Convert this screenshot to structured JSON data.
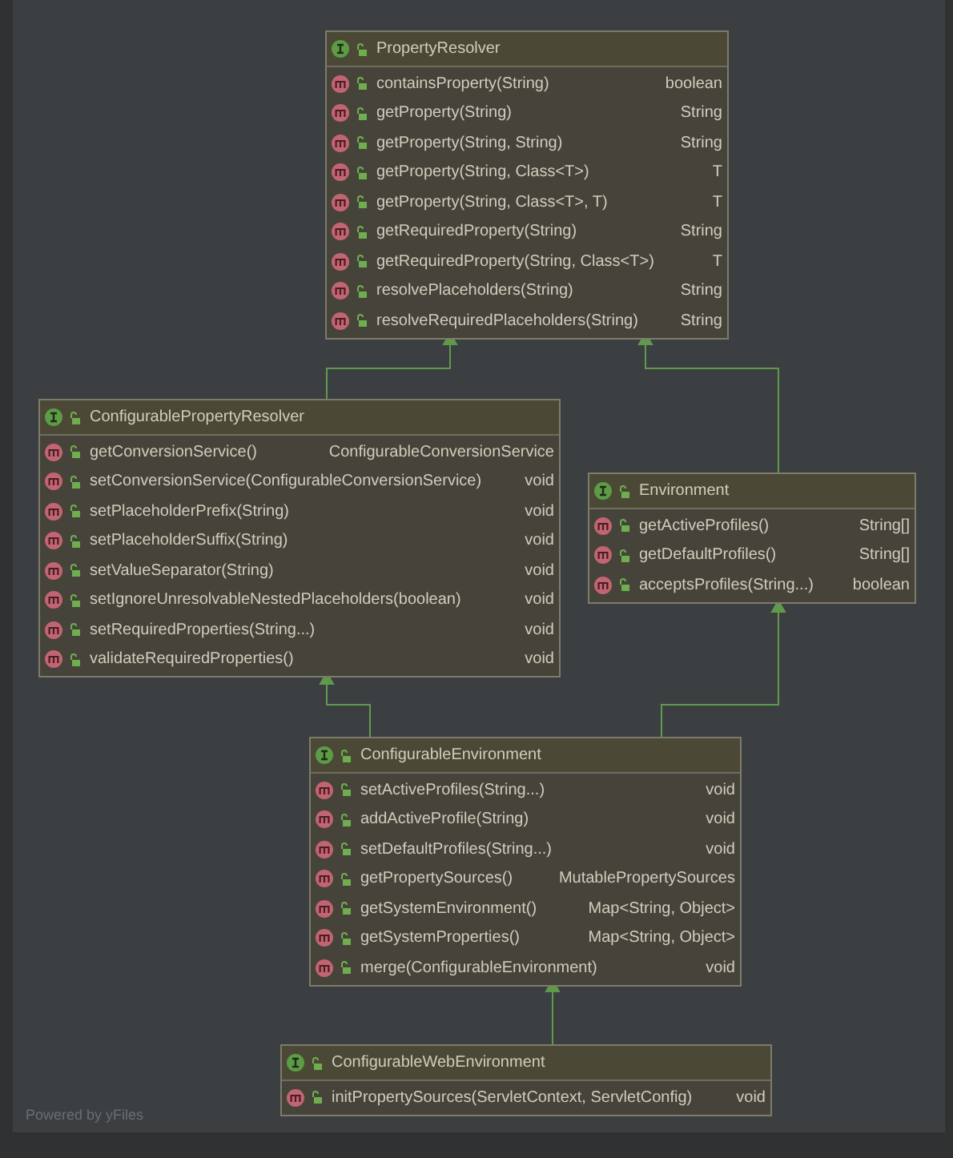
{
  "diagram": {
    "nodes": [
      {
        "name": "PropertyResolver",
        "methods": [
          {
            "name": "containsProperty(String)",
            "returns": "boolean"
          },
          {
            "name": "getProperty(String)",
            "returns": "String"
          },
          {
            "name": "getProperty(String, String)",
            "returns": "String"
          },
          {
            "name": "getProperty(String, Class<T>)",
            "returns": "T"
          },
          {
            "name": "getProperty(String, Class<T>, T)",
            "returns": "T"
          },
          {
            "name": "getRequiredProperty(String)",
            "returns": "String"
          },
          {
            "name": "getRequiredProperty(String, Class<T>)",
            "returns": "T"
          },
          {
            "name": "resolvePlaceholders(String)",
            "returns": "String"
          },
          {
            "name": "resolveRequiredPlaceholders(String)",
            "returns": "String"
          }
        ]
      },
      {
        "name": "ConfigurablePropertyResolver",
        "methods": [
          {
            "name": "getConversionService()",
            "returns": "ConfigurableConversionService"
          },
          {
            "name": "setConversionService(ConfigurableConversionService)",
            "returns": "void"
          },
          {
            "name": "setPlaceholderPrefix(String)",
            "returns": "void"
          },
          {
            "name": "setPlaceholderSuffix(String)",
            "returns": "void"
          },
          {
            "name": "setValueSeparator(String)",
            "returns": "void"
          },
          {
            "name": "setIgnoreUnresolvableNestedPlaceholders(boolean)",
            "returns": "void"
          },
          {
            "name": "setRequiredProperties(String...)",
            "returns": "void"
          },
          {
            "name": "validateRequiredProperties()",
            "returns": "void"
          }
        ]
      },
      {
        "name": "Environment",
        "methods": [
          {
            "name": "getActiveProfiles()",
            "returns": "String[]"
          },
          {
            "name": "getDefaultProfiles()",
            "returns": "String[]"
          },
          {
            "name": "acceptsProfiles(String...)",
            "returns": "boolean"
          }
        ]
      },
      {
        "name": "ConfigurableEnvironment",
        "methods": [
          {
            "name": "setActiveProfiles(String...)",
            "returns": "void"
          },
          {
            "name": "addActiveProfile(String)",
            "returns": "void"
          },
          {
            "name": "setDefaultProfiles(String...)",
            "returns": "void"
          },
          {
            "name": "getPropertySources()",
            "returns": "MutablePropertySources"
          },
          {
            "name": "getSystemEnvironment()",
            "returns": "Map<String, Object>"
          },
          {
            "name": "getSystemProperties()",
            "returns": "Map<String, Object>"
          },
          {
            "name": "merge(ConfigurableEnvironment)",
            "returns": "void"
          }
        ]
      },
      {
        "name": "ConfigurableWebEnvironment",
        "methods": [
          {
            "name": "initPropertySources(ServletContext, ServletConfig)",
            "returns": "void"
          }
        ]
      }
    ]
  },
  "footer": "Powered by yFiles"
}
